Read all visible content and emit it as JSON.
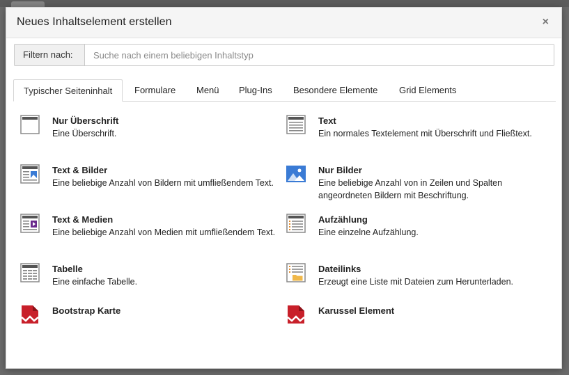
{
  "dialog": {
    "title": "Neues Inhaltselement erstellen",
    "close_symbol": "×"
  },
  "filter": {
    "label": "Filtern nach:",
    "placeholder": "Suche nach einem beliebigen Inhaltstyp",
    "value": ""
  },
  "tabs": [
    {
      "label": "Typischer Seiteninhalt",
      "active": true
    },
    {
      "label": "Formulare",
      "active": false
    },
    {
      "label": "Menü",
      "active": false
    },
    {
      "label": "Plug-Ins",
      "active": false
    },
    {
      "label": "Besondere Elemente",
      "active": false
    },
    {
      "label": "Grid Elements",
      "active": false
    }
  ],
  "items": [
    {
      "title": "Nur Überschrift",
      "description": "Eine Überschrift.",
      "icon": "header-only-icon"
    },
    {
      "title": "Text",
      "description": "Ein normales Textelement mit Überschrift und Fließtext.",
      "icon": "text-icon"
    },
    {
      "title": "Text & Bilder",
      "description": "Eine beliebige Anzahl von Bildern mit umfließendem Text.",
      "icon": "text-images-icon"
    },
    {
      "title": "Nur Bilder",
      "description": "Eine beliebige Anzahl von in Zeilen und Spalten angeordneten Bildern mit Beschriftung.",
      "icon": "images-only-icon"
    },
    {
      "title": "Text & Medien",
      "description": "Eine beliebige Anzahl von Medien mit umfließendem Text.",
      "icon": "text-media-icon"
    },
    {
      "title": "Aufzählung",
      "description": "Eine einzelne Aufzählung.",
      "icon": "bullet-list-icon"
    },
    {
      "title": "Tabelle",
      "description": "Eine einfache Tabelle.",
      "icon": "table-icon"
    },
    {
      "title": "Dateilinks",
      "description": "Erzeugt eine Liste mit Dateien zum Herunterladen.",
      "icon": "file-links-icon"
    },
    {
      "title": "Bootstrap Karte",
      "description": "",
      "icon": "bootstrap-card-icon"
    },
    {
      "title": "Karussel Element",
      "description": "",
      "icon": "carousel-icon"
    }
  ],
  "colors": {
    "accent_blue": "#3a7bd5",
    "plugin_red": "#c8202a",
    "icon_gray": "#6b6b6b"
  }
}
